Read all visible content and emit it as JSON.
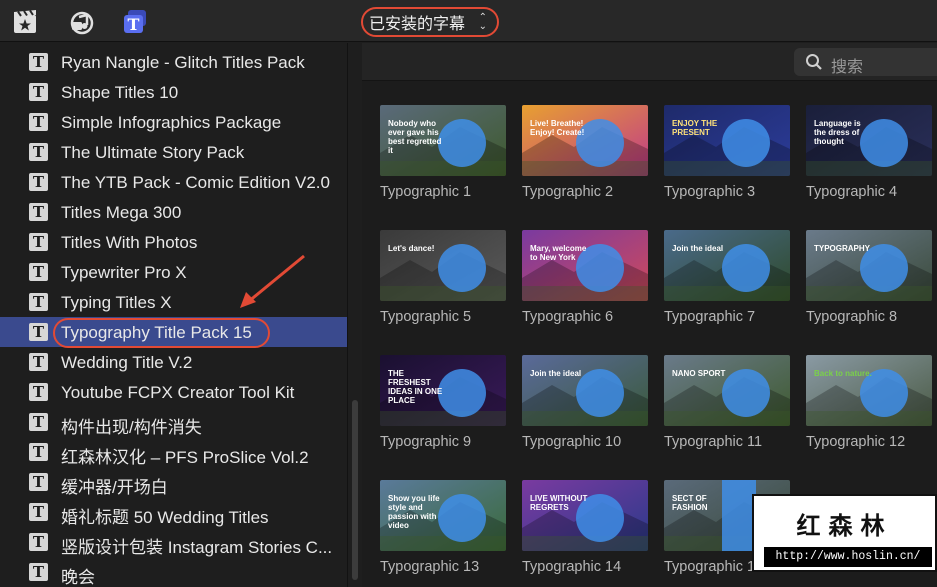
{
  "toolbar": {
    "icons": [
      "clapper-star-icon",
      "music-camera-icon",
      "titles-icon"
    ],
    "dropdown_label": "已安装的字幕",
    "accent": "#e24a35"
  },
  "search": {
    "placeholder": "搜索"
  },
  "sidebar": {
    "items": [
      {
        "label": "Ryan Nangle - Glitch Titles Pack"
      },
      {
        "label": "Shape Titles 10"
      },
      {
        "label": "Simple Infographics Package"
      },
      {
        "label": "The Ultimate Story Pack"
      },
      {
        "label": "The YTB Pack - Comic Edition V2.0"
      },
      {
        "label": "Titles Mega 300"
      },
      {
        "label": "Titles With Photos"
      },
      {
        "label": "Typewriter Pro X"
      },
      {
        "label": "Typing Titles X"
      },
      {
        "label": "Typography Title Pack 15",
        "selected": true
      },
      {
        "label": "Wedding Title V.2"
      },
      {
        "label": "Youtube FCPX Creator Tool Kit"
      },
      {
        "label": "构件出现/构件消失"
      },
      {
        "label": "红森林汉化 – PFS ProSlice Vol.2"
      },
      {
        "label": "缓冲器/开场白"
      },
      {
        "label": "婚礼标题 50 Wedding Titles"
      },
      {
        "label": "竖版设计包装 Instagram Stories C..."
      },
      {
        "label": "晚会"
      }
    ],
    "selected_color": "#3a4a8e"
  },
  "grid": {
    "tiles": [
      {
        "label": "Typographic 1",
        "thumb_text": "Nobody who ever gave his best regretted it"
      },
      {
        "label": "Typographic 2",
        "thumb_text": "Live! Breathe! Enjoy! Create!"
      },
      {
        "label": "Typographic 3",
        "thumb_text": "ENJOY THE PRESENT"
      },
      {
        "label": "Typographic 4",
        "thumb_text": "Language is the dress of thought"
      },
      {
        "label": "Typographic 5",
        "thumb_text": "Let's dance!"
      },
      {
        "label": "Typographic 6",
        "thumb_text": "Mary, welcome to New York"
      },
      {
        "label": "Typographic 7",
        "thumb_text": "Join the ideal"
      },
      {
        "label": "Typographic 8",
        "thumb_text": "TYPOGRAPHY"
      },
      {
        "label": "Typographic 9",
        "thumb_text": "THE FRESHEST IDEAS IN ONE PLACE"
      },
      {
        "label": "Typographic 10",
        "thumb_text": "Join the ideal"
      },
      {
        "label": "Typographic 11",
        "thumb_text": "NANO SPORT"
      },
      {
        "label": "Typographic 12",
        "thumb_text": "Back to nature."
      },
      {
        "label": "Typographic 13",
        "thumb_text": "Show you life style and passion with video"
      },
      {
        "label": "Typographic 14",
        "thumb_text": "LIVE WITHOUT REGRETS"
      },
      {
        "label": "Typographic 15",
        "thumb_text": "SECT OF FASHION"
      }
    ]
  },
  "watermark": {
    "title": "红森林",
    "url": "http://www.hoslin.cn/"
  }
}
